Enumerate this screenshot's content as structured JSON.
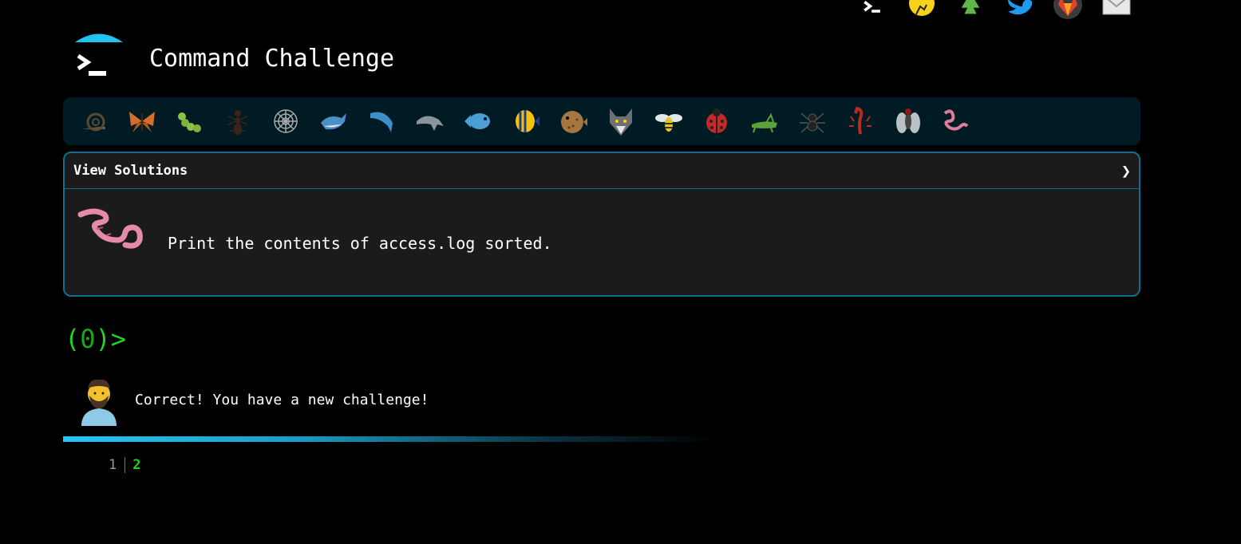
{
  "header": {
    "title": "Command Challenge",
    "top_icons": [
      "terminal-icon",
      "hand-bulb-icon",
      "tree-icon",
      "twitter-icon",
      "gitlab-icon",
      "mail-icon"
    ]
  },
  "animals": [
    "snail",
    "butterfly",
    "caterpillar",
    "ant",
    "spider-web",
    "whale",
    "dolphin-blue",
    "dolphin-grey",
    "fish",
    "tropical-fish",
    "blowfish",
    "wolf",
    "bee",
    "ladybug",
    "cricket",
    "spider",
    "scorpion",
    "fly",
    "worm"
  ],
  "panel": {
    "toggle_label": "View Solutions",
    "chevron": "❯",
    "challenge_text": "Print the contents of access.log sorted."
  },
  "terminal": {
    "prompt_open": "(",
    "prompt_number": "0",
    "prompt_close": ")>"
  },
  "feedback": {
    "message": "Correct! You have a new challenge!"
  },
  "levels": {
    "completed": "1",
    "current": "2"
  },
  "progress": {
    "percent": 53
  },
  "colors": {
    "accent": "#27c4f3",
    "panel_border": "#0f6f93",
    "prompt_green": "#1fd41f",
    "animals_bar": "#001b24"
  }
}
